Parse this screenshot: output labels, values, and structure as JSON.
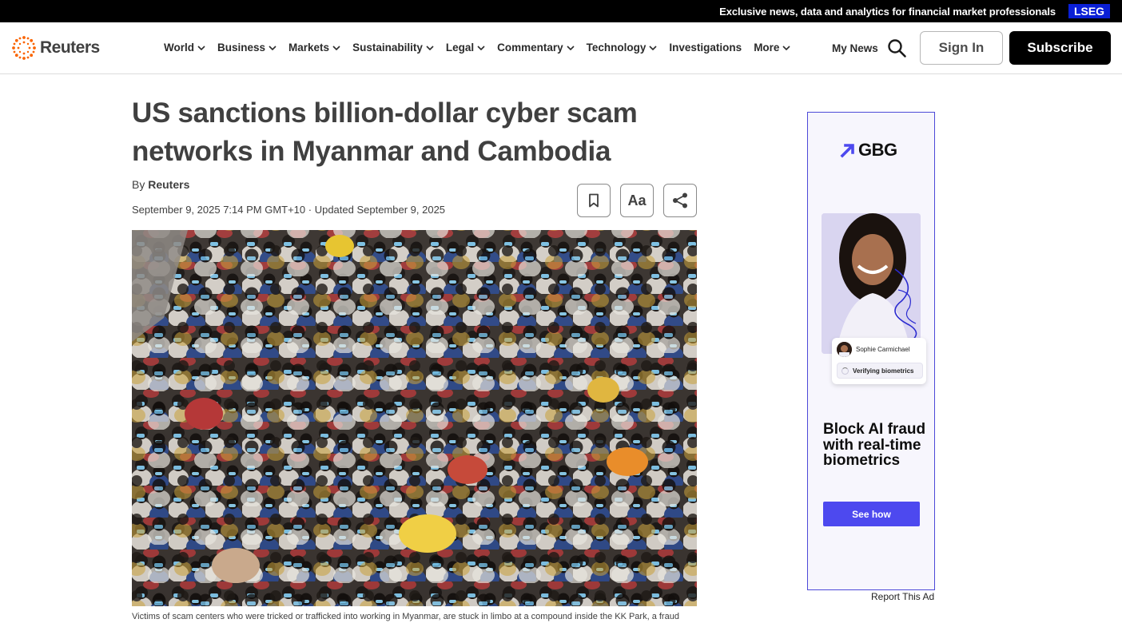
{
  "banner": {
    "message": "Exclusive news, data and analytics for financial market professionals",
    "badge": "LSEG"
  },
  "header": {
    "logo_text": "Reuters",
    "nav": [
      {
        "label": "World",
        "has_dropdown": true
      },
      {
        "label": "Business",
        "has_dropdown": true
      },
      {
        "label": "Markets",
        "has_dropdown": true
      },
      {
        "label": "Sustainability",
        "has_dropdown": true
      },
      {
        "label": "Legal",
        "has_dropdown": true
      },
      {
        "label": "Commentary",
        "has_dropdown": true
      },
      {
        "label": "Technology",
        "has_dropdown": true
      },
      {
        "label": "Investigations",
        "has_dropdown": false
      },
      {
        "label": "More",
        "has_dropdown": true
      }
    ],
    "my_news": "My News",
    "search_icon": "search-icon",
    "sign_in": "Sign In",
    "subscribe": "Subscribe"
  },
  "article": {
    "headline": "US sanctions billion-dollar cyber scam networks in Myanmar and Cambodia",
    "byline_prefix": "By ",
    "author": "Reuters",
    "dateline": "September 9, 2025 7:14 PM GMT+10 · Updated September 9, 2025",
    "tools": {
      "bookmark_icon": "bookmark-icon",
      "font_label": "Aa",
      "share_icon": "share-icon"
    },
    "image_caption": "Victims of scam centers who were tricked or trafficked into working in Myanmar, are stuck in limbo at a compound inside the KK Park, a fraud"
  },
  "ad": {
    "brand": "GBG",
    "person_name": "Sophie Carmichael",
    "status": "Verifying biometrics",
    "headline": "Block AI fraud with real-time biometrics",
    "cta": "See how",
    "report": "Report This Ad"
  },
  "colors": {
    "banner_bg": "#000000",
    "lseg_blue": "#0a1fd6",
    "reuters_orange": "#fa6400",
    "text": "#404040",
    "ad_accent": "#4d49ef"
  }
}
